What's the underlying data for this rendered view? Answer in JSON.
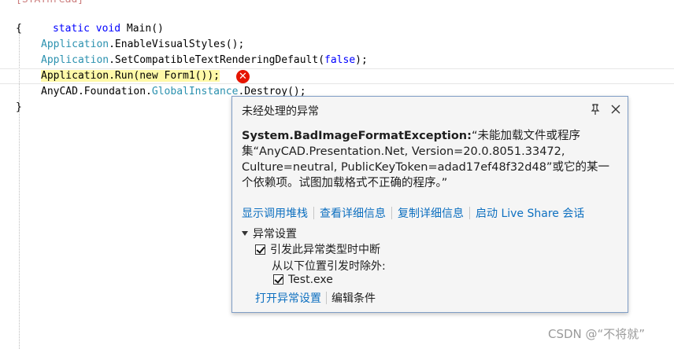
{
  "code": {
    "line0": "[STAThread]",
    "line1": "static void Main()",
    "line2": "{",
    "line3_type": "Application",
    "line3_rest": ".EnableVisualStyles();",
    "line4_type": "Application",
    "line4_mid": ".SetCompatibleTextRenderingDefault(",
    "line4_kw": "false",
    "line4_end": ");",
    "line5": "Application.Run(new Form1());",
    "line6_a": "AnyCAD.Foundation.",
    "line6_type": "GlobalInstance",
    "line6_b": ".Destroy();",
    "line7": "}"
  },
  "error_icon": "error-x-icon",
  "popup": {
    "title": "未经处理的异常",
    "exception_type": "System.BadImageFormatException:",
    "message": "“未能加载文件或程序集“AnyCAD.Presentation.Net, Version=20.0.8051.33472, Culture=neutral, PublicKeyToken=adad17ef48f32d48”或它的某一个依赖项。试图加载格式不正确的程序。”",
    "links": [
      "显示调用堆栈",
      "查看详细信息",
      "复制详细信息",
      "启动 Live Share 会话"
    ],
    "settings_header": "异常设置",
    "break_option": "引发此异常类型时中断",
    "except_label": "从以下位置引发时除外:",
    "except_item": "Test.exe",
    "open_settings": "打开异常设置",
    "edit_conditions": "编辑条件",
    "accent_color": "#0e70c0",
    "error_color": "#e51400"
  },
  "watermark": "CSDN @“不将就”"
}
